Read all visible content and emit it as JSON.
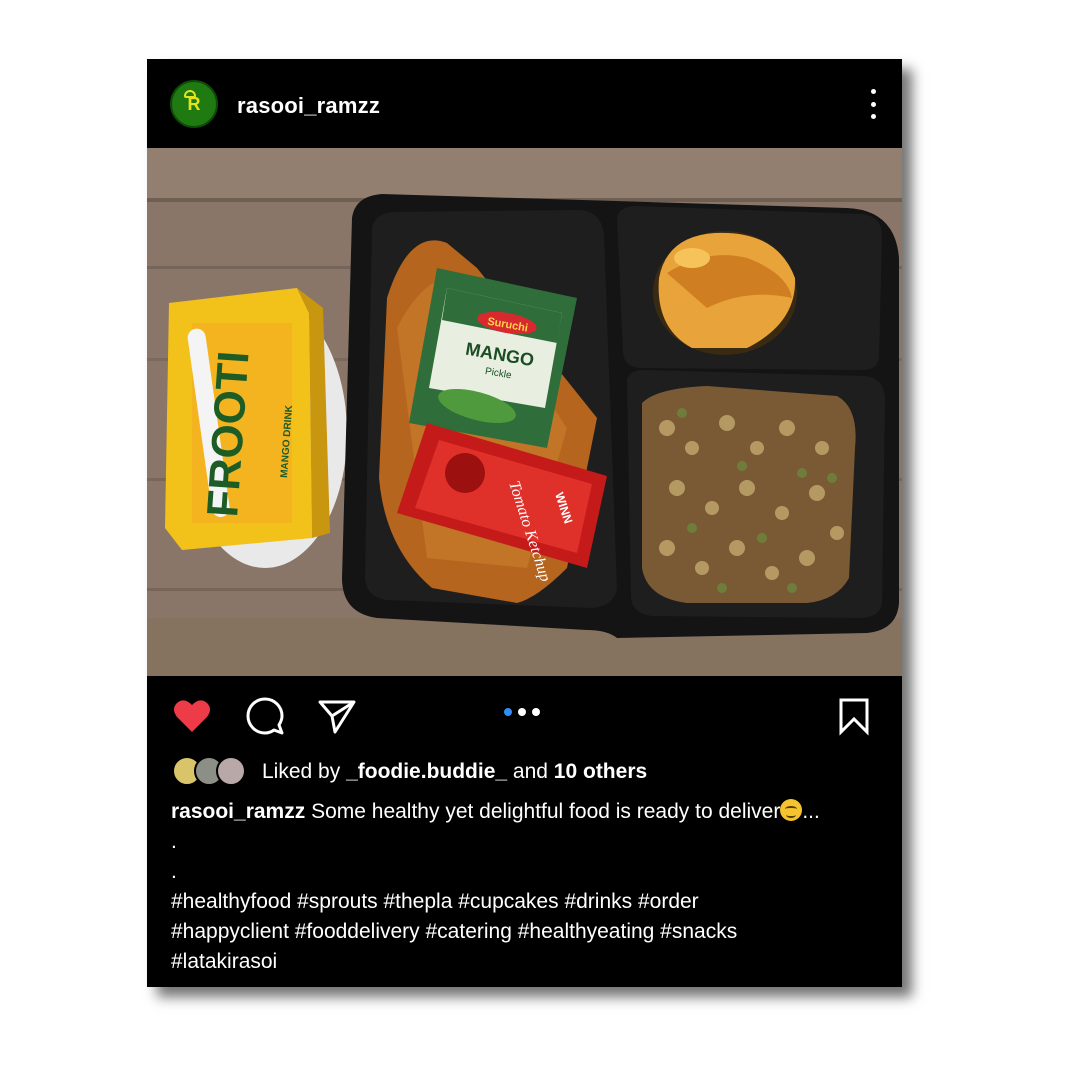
{
  "post": {
    "username": "rasooi_ramzz",
    "avatar_letter": "R",
    "more_icon": "more-vertical-icon"
  },
  "photo": {
    "juice_brand": "FROOTI",
    "juice_sub": "MANGO DRINK",
    "pickle_brand": "Suruchi",
    "pickle_name": "MANGO",
    "pickle_sub": "Pickle",
    "ketchup_brand": "WINN",
    "ketchup_name": "Tomato Ketchup"
  },
  "actions": {
    "like_icon": "heart-filled-icon",
    "comment_icon": "comment-icon",
    "share_icon": "send-icon",
    "save_icon": "bookmark-icon",
    "carousel_count": 3,
    "carousel_active": 1,
    "like_color": "#ed3b48",
    "dot_active_color": "#2f8df5"
  },
  "likes": {
    "prefix": "Liked by ",
    "user": "_foodie.buddie_",
    "middle": " and ",
    "others": "10 others"
  },
  "caption": {
    "user": "rasooi_ramzz",
    "text": " Some healthy yet delightful food is ready to deliver",
    "ellipsis": "...",
    "dot1": ".",
    "dot2": ".",
    "hashtags_line1": "#healthyfood #sprouts #thepla #cupcakes #drinks #order",
    "hashtags_line2": "#happyclient #fooddelivery #catering #healthyeating #snacks",
    "hashtags_line3": "#latakirasoi"
  }
}
